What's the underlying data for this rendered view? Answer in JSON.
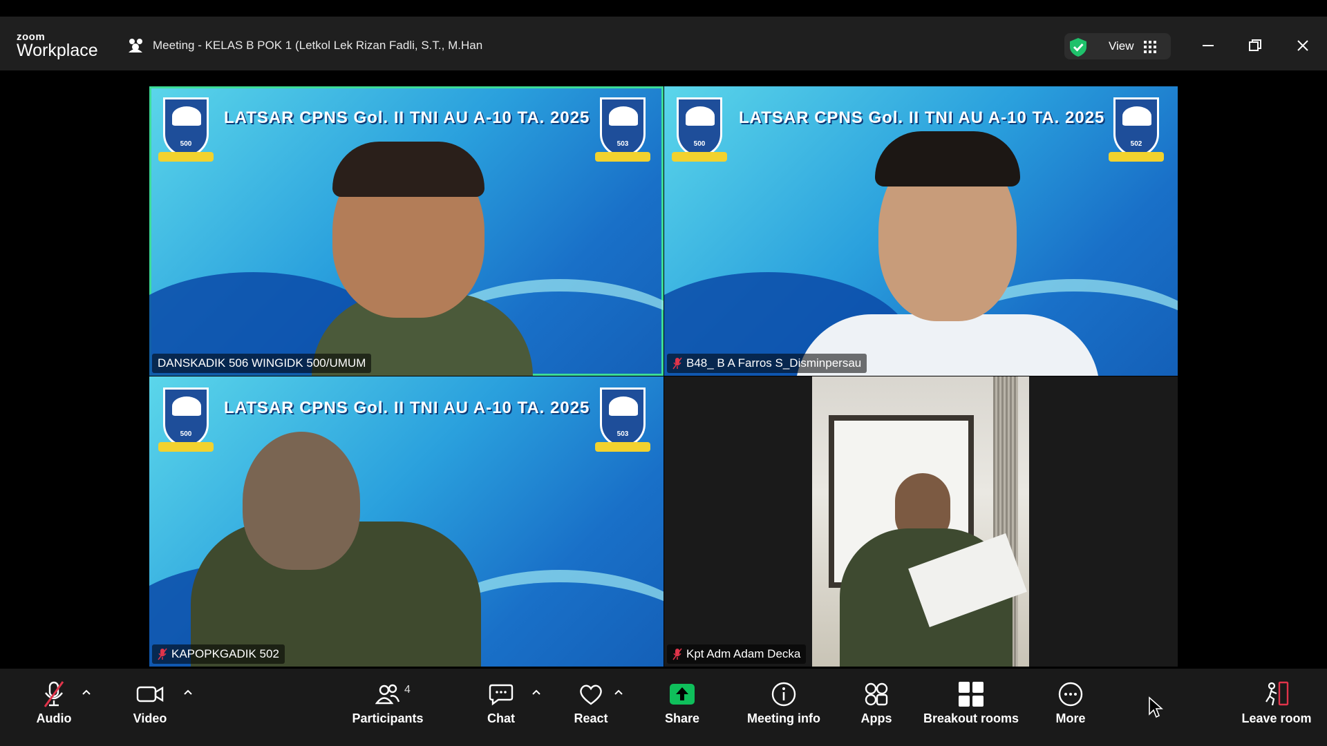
{
  "app": {
    "brand_top": "zoom",
    "brand_bottom": "Workplace"
  },
  "meeting": {
    "title": "Meeting - KELAS B POK 1 (Letkol Lek Rizan Fadli, S.T., M.Han"
  },
  "view_button": {
    "label": "View"
  },
  "tiles": [
    {
      "name": "DANSKADIK 506 WINGIDK 500/UMUM",
      "muted": false,
      "active": true,
      "banner": "LATSAR CPNS  Gol. II  TNI AU A-10 TA. 2025",
      "emblem_left": "500",
      "emblem_right": "503"
    },
    {
      "name": "B48_ B A Farros S_Disminpersau",
      "muted": true,
      "active": false,
      "banner": "LATSAR CPNS  Gol. II  TNI AU A-10 TA. 2025",
      "emblem_left": "500",
      "emblem_right": "502"
    },
    {
      "name": "KAPOPKGADIK 502",
      "muted": true,
      "active": false,
      "banner": "LATSAR CPNS  Gol. II  TNI AU A-10 TA. 2025",
      "emblem_left": "500",
      "emblem_right": "503"
    },
    {
      "name": "Kpt Adm Adam Decka",
      "muted": true,
      "active": false
    }
  ],
  "toolbar": {
    "audio": "Audio",
    "video": "Video",
    "participants": "Participants",
    "participants_count": "4",
    "chat": "Chat",
    "react": "React",
    "share": "Share",
    "meeting_info": "Meeting info",
    "apps": "Apps",
    "breakout_rooms": "Breakout rooms",
    "more": "More",
    "leave_room": "Leave room"
  },
  "colors": {
    "active_speaker": "#3ddc97",
    "share_green": "#0fbf5b",
    "muted_red": "#e0344a",
    "toolbar_bg": "#1a1a1a"
  }
}
